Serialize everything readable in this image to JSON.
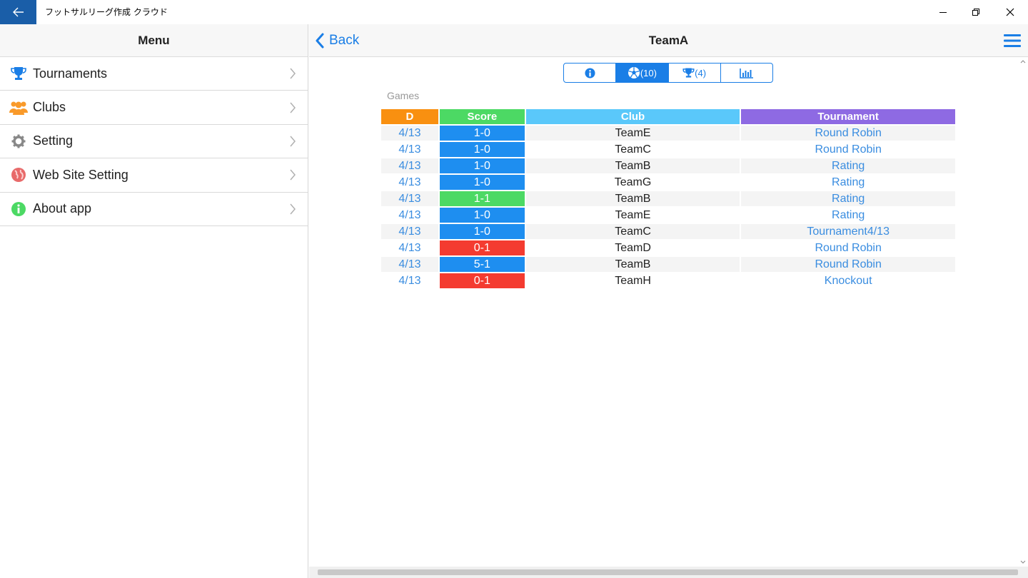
{
  "window": {
    "title": "フットサルリーグ作成 クラウド",
    "accent": "#1a5ea8"
  },
  "sidebar": {
    "header": "Menu",
    "items": [
      {
        "label": "Tournaments",
        "icon": "trophy-icon",
        "color": "#1a7ee6"
      },
      {
        "label": "Clubs",
        "icon": "users-icon",
        "color": "#f99a2a"
      },
      {
        "label": "Setting",
        "icon": "gear-icon",
        "color": "#888888"
      },
      {
        "label": "Web Site Setting",
        "icon": "globe-icon",
        "color": "#e86a6a"
      },
      {
        "label": "About app",
        "icon": "info-icon",
        "color": "#4cd964"
      }
    ]
  },
  "main": {
    "back_label": "Back",
    "title": "TeamA",
    "tabs": [
      {
        "icon": "info-icon",
        "label": ""
      },
      {
        "icon": "soccer-ball-icon",
        "label": "(10)"
      },
      {
        "icon": "trophy-icon",
        "label": "(4)"
      },
      {
        "icon": "bar-chart-icon",
        "label": ""
      }
    ],
    "games_label": "Games",
    "columns": [
      "D",
      "Score",
      "Club",
      "Tournament"
    ],
    "rows": [
      {
        "date": "4/13",
        "score": "1-0",
        "result": "win",
        "club": "TeamE",
        "tournament": "Round Robin"
      },
      {
        "date": "4/13",
        "score": "1-0",
        "result": "win",
        "club": "TeamC",
        "tournament": "Round Robin"
      },
      {
        "date": "4/13",
        "score": "1-0",
        "result": "win",
        "club": "TeamB",
        "tournament": "Rating"
      },
      {
        "date": "4/13",
        "score": "1-0",
        "result": "win",
        "club": "TeamG",
        "tournament": "Rating"
      },
      {
        "date": "4/13",
        "score": "1-1",
        "result": "draw",
        "club": "TeamB",
        "tournament": "Rating"
      },
      {
        "date": "4/13",
        "score": "1-0",
        "result": "win",
        "club": "TeamE",
        "tournament": "Rating"
      },
      {
        "date": "4/13",
        "score": "1-0",
        "result": "win",
        "club": "TeamC",
        "tournament": "Tournament4/13"
      },
      {
        "date": "4/13",
        "score": "0-1",
        "result": "loss",
        "club": "TeamD",
        "tournament": "Round Robin"
      },
      {
        "date": "4/13",
        "score": "5-1",
        "result": "win",
        "club": "TeamB",
        "tournament": "Round Robin"
      },
      {
        "date": "4/13",
        "score": "0-1",
        "result": "loss",
        "club": "TeamH",
        "tournament": "Knockout"
      }
    ]
  }
}
